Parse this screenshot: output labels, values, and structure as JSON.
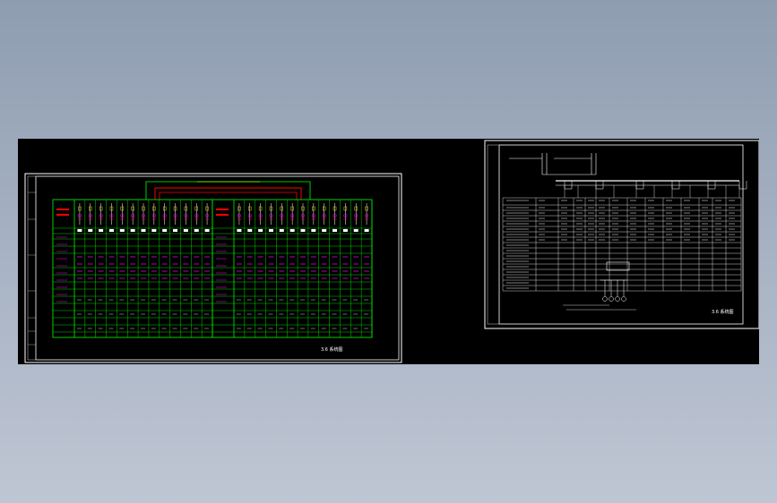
{
  "viewport": {
    "background": "#000000",
    "page_background": "#9aa6b8"
  },
  "colors": {
    "frame": "#ffffff",
    "grid": "#00ff00",
    "text_magenta": "#ff00ff",
    "wire_red": "#ff0000",
    "wire_yellow": "#ffff00",
    "bus_green": "#00ff00"
  },
  "sheets": [
    {
      "id": "left-sheet",
      "kind": "low-voltage switchgear single-line schedule",
      "panel_groups": 2,
      "columns_per_group": 13,
      "title_text": "3.6 系统图"
    },
    {
      "id": "right-sheet",
      "kind": "distribution schematic",
      "title_text": "3.6 系统图"
    }
  ]
}
